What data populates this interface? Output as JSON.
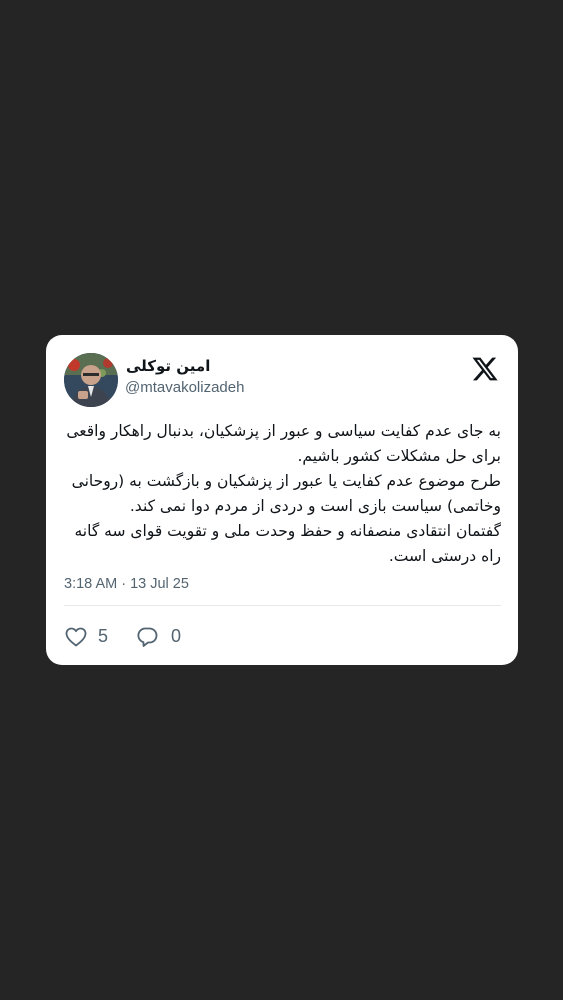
{
  "tweet": {
    "author": {
      "display_name": "امین توکلی",
      "handle": "@mtavakolizadeh",
      "avatar_icon": "user-avatar"
    },
    "platform_icon": "x-logo-icon",
    "text_lines": [
      "به جای عدم کفایت سیاسی و عبور از پزشکیان، بدنبال راهکار واقعی",
      "برای حل مشکلات کشور باشیم.",
      "طرح موضوع عدم کفایت یا عبور از پزشکیان و بازگشت به (روحانی",
      "وخاتمی) سیاست بازی است و دردی از مردم دوا نمی کند.",
      "گفتمان انتقادی منصفانه و حفظ وحدت ملی و تقویت قوای سه گانه",
      "راه درستی است."
    ],
    "timestamp": "3:18 AM · 13 Jul 25",
    "likes": {
      "icon": "heart-icon",
      "count": "5"
    },
    "replies": {
      "icon": "reply-icon",
      "count": "0"
    }
  },
  "colors": {
    "background": "#252525",
    "card": "#ffffff",
    "text": "#0f1419",
    "secondary_text": "#536471",
    "divider": "#e6e9eb"
  }
}
